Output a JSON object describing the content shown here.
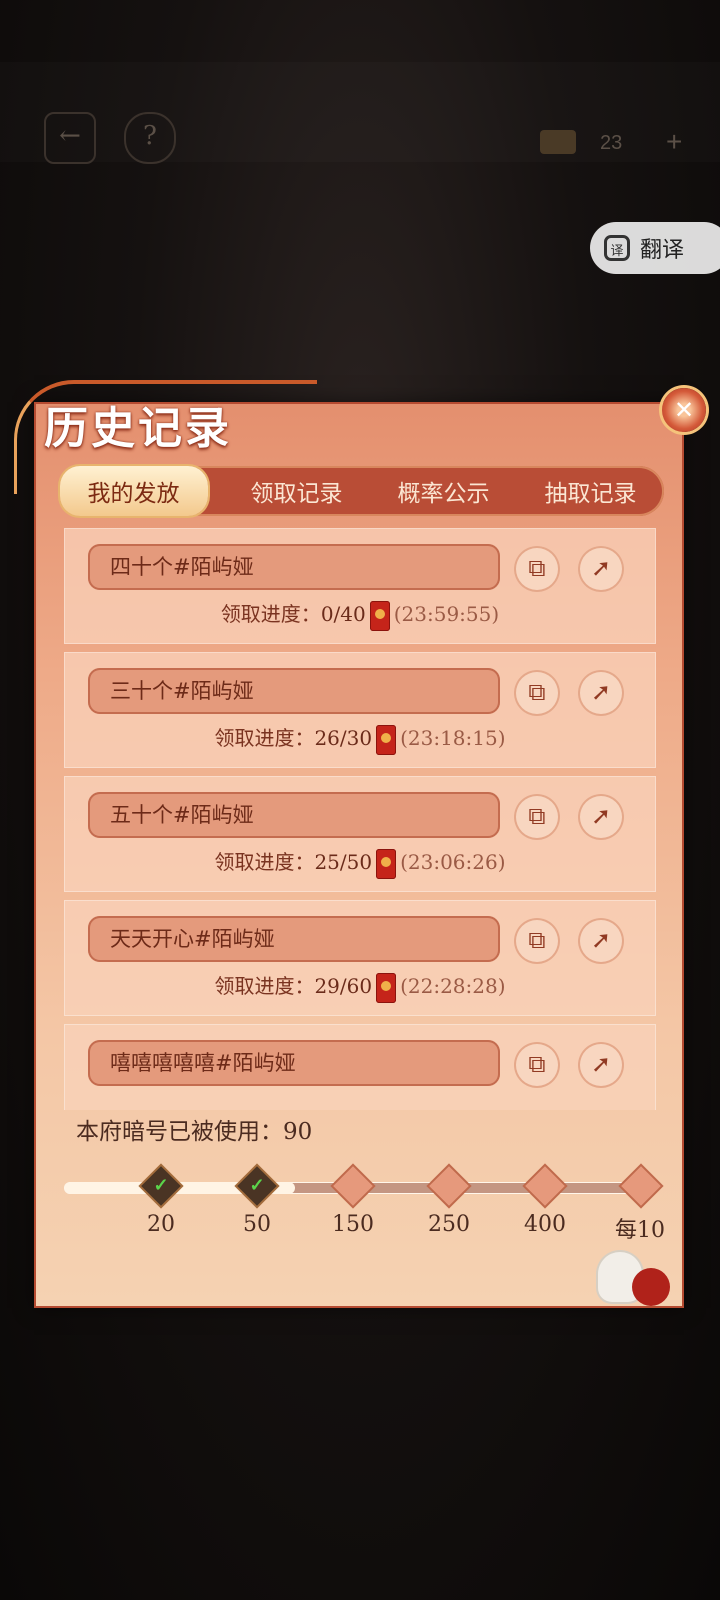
{
  "topbar": {
    "back_icon": "←",
    "help_icon": "?",
    "coin_count": "23",
    "plus_icon": "+"
  },
  "translate": {
    "icon_label": "译",
    "label": "翻译"
  },
  "panel": {
    "title": "历史记录",
    "close_icon": "✕",
    "tabs": [
      {
        "label": "我的发放",
        "active": true
      },
      {
        "label": "领取记录",
        "active": false
      },
      {
        "label": "概率公示",
        "active": false
      },
      {
        "label": "抽取记录",
        "active": false
      }
    ],
    "progress_prefix": "领取进度：",
    "records": [
      {
        "name": "四十个#陌屿娅",
        "progress": "0/40",
        "time": "(23:59:55)"
      },
      {
        "name": "三十个#陌屿娅",
        "progress": "26/30",
        "time": "(23:18:15)"
      },
      {
        "name": "五十个#陌屿娅",
        "progress": "25/50",
        "time": "(23:06:26)"
      },
      {
        "name": "天天开心#陌屿娅",
        "progress": "29/60",
        "time": "(22:28:28)"
      },
      {
        "name": "嘻嘻嘻嘻嘻#陌屿娅",
        "progress": "",
        "time": ""
      }
    ],
    "usage": {
      "label": "本府暗号已被使用：90",
      "used": 90
    },
    "milestones": [
      {
        "label": "20",
        "done": true
      },
      {
        "label": "50",
        "done": true
      },
      {
        "label": "150",
        "done": false
      },
      {
        "label": "250",
        "done": false
      },
      {
        "label": "400",
        "done": false
      },
      {
        "label": "每10",
        "done": false
      }
    ],
    "track_fill_fraction": 0.39
  },
  "colors": {
    "panel_top": "#e48f6e",
    "panel_bottom": "#f5d2b2",
    "tab_bar": "#b94d36",
    "accent_text": "#7c2a12"
  }
}
